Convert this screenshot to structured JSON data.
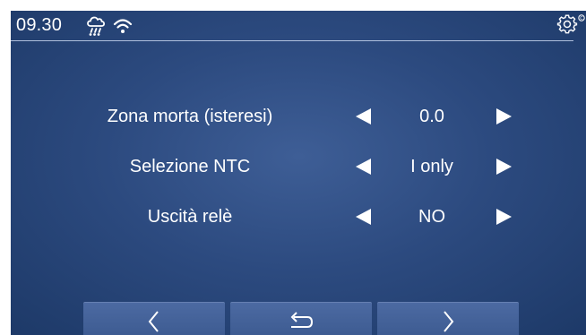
{
  "status_bar": {
    "time": "09.30",
    "weather_icon": "cloud-drizzle-icon",
    "wifi_icon": "wifi-icon",
    "settings_icon": "gear-icon"
  },
  "settings": {
    "rows": [
      {
        "label": "Zona morta (isteresi)",
        "value": "0.0"
      },
      {
        "label": "Selezione NTC",
        "value": "I only"
      },
      {
        "label": "Uscità relè",
        "value": "NO"
      }
    ]
  },
  "nav": {
    "buttons": [
      "previous-chevron-icon",
      "back-return-icon",
      "next-chevron-icon"
    ]
  },
  "colors": {
    "background": "#2c4a7f",
    "button": "#44629a",
    "text": "#ffffff"
  }
}
